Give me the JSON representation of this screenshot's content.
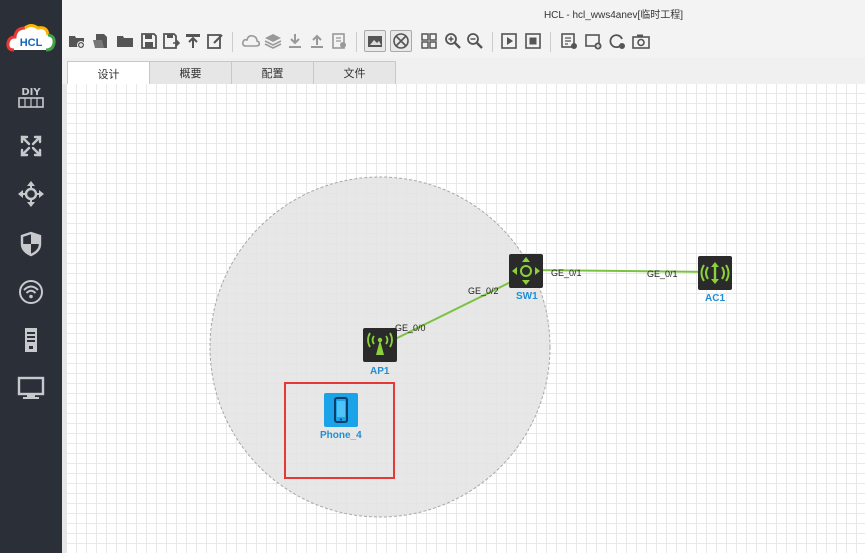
{
  "window": {
    "title": "HCL - hcl_wws4anev[临时工程]"
  },
  "logo": {
    "text": "HCL"
  },
  "sidebar": {
    "items": [
      {
        "icon": "diy-icon",
        "label": "DIY"
      },
      {
        "icon": "router-icon"
      },
      {
        "icon": "switch-icon"
      },
      {
        "icon": "firewall-icon"
      },
      {
        "icon": "wireless-icon"
      },
      {
        "icon": "server-icon"
      },
      {
        "icon": "terminal-icon"
      }
    ]
  },
  "tabs": [
    {
      "label": "设计",
      "active": true
    },
    {
      "label": "概要",
      "active": false
    },
    {
      "label": "配置",
      "active": false
    },
    {
      "label": "文件",
      "active": false
    }
  ],
  "topology": {
    "devices": [
      {
        "name": "SW1",
        "type": "switch"
      },
      {
        "name": "AC1",
        "type": "ac"
      },
      {
        "name": "AP1",
        "type": "ap"
      },
      {
        "name": "Phone_4",
        "type": "phone"
      }
    ],
    "links": [
      {
        "from": "SW1",
        "from_port": "GE_0/1",
        "to": "AC1",
        "to_port": "GE_0/1"
      },
      {
        "from": "SW1",
        "from_port": "GE_0/2",
        "to": "AP1",
        "to_port": "GE_0/0"
      }
    ]
  },
  "colors": {
    "sidebar_bg": "#2b2f38",
    "label_blue": "#1e8fd6",
    "link_green": "#7cc242",
    "selection_red": "#e53935",
    "device_dark": "#2a2a2a",
    "device_green": "#8ad13c",
    "phone_blue": "#1aa3e8"
  }
}
